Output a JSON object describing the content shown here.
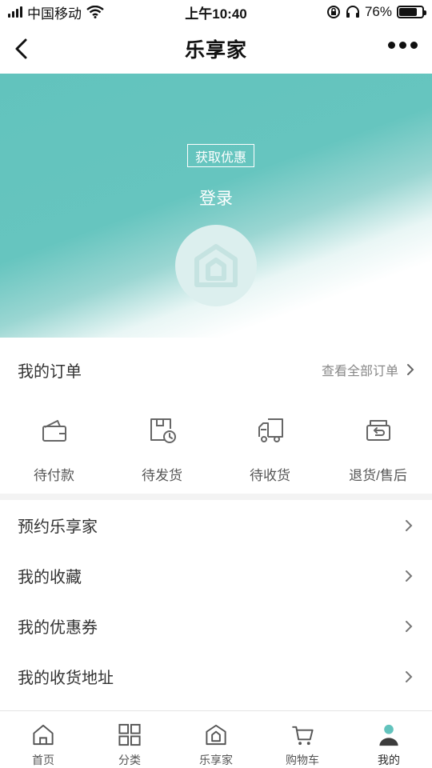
{
  "status_bar": {
    "carrier": "中国移动",
    "time": "上午10:40",
    "battery": "76%"
  },
  "nav": {
    "title": "乐享家"
  },
  "hero": {
    "promo_tag": "获取优惠",
    "login": "登录"
  },
  "orders": {
    "title": "我的订单",
    "view_all": "查看全部订单",
    "items": [
      {
        "label": "待付款",
        "icon": "wallet-icon"
      },
      {
        "label": "待发货",
        "icon": "package-clock-icon"
      },
      {
        "label": "待收货",
        "icon": "truck-icon"
      },
      {
        "label": "退货/售后",
        "icon": "return-icon"
      }
    ]
  },
  "menu": {
    "items": [
      {
        "label": "预约乐享家"
      },
      {
        "label": "我的收藏"
      },
      {
        "label": "我的优惠券"
      },
      {
        "label": "我的收货地址"
      }
    ]
  },
  "tab_bar": {
    "tabs": [
      {
        "label": "首页",
        "icon": "home-icon"
      },
      {
        "label": "分类",
        "icon": "grid-icon"
      },
      {
        "label": "乐享家",
        "icon": "house-logo-icon"
      },
      {
        "label": "购物车",
        "icon": "cart-icon"
      },
      {
        "label": "我的",
        "icon": "user-icon"
      }
    ]
  },
  "colors": {
    "accent": "#62c3bd",
    "text": "#333333",
    "muted": "#888888"
  }
}
